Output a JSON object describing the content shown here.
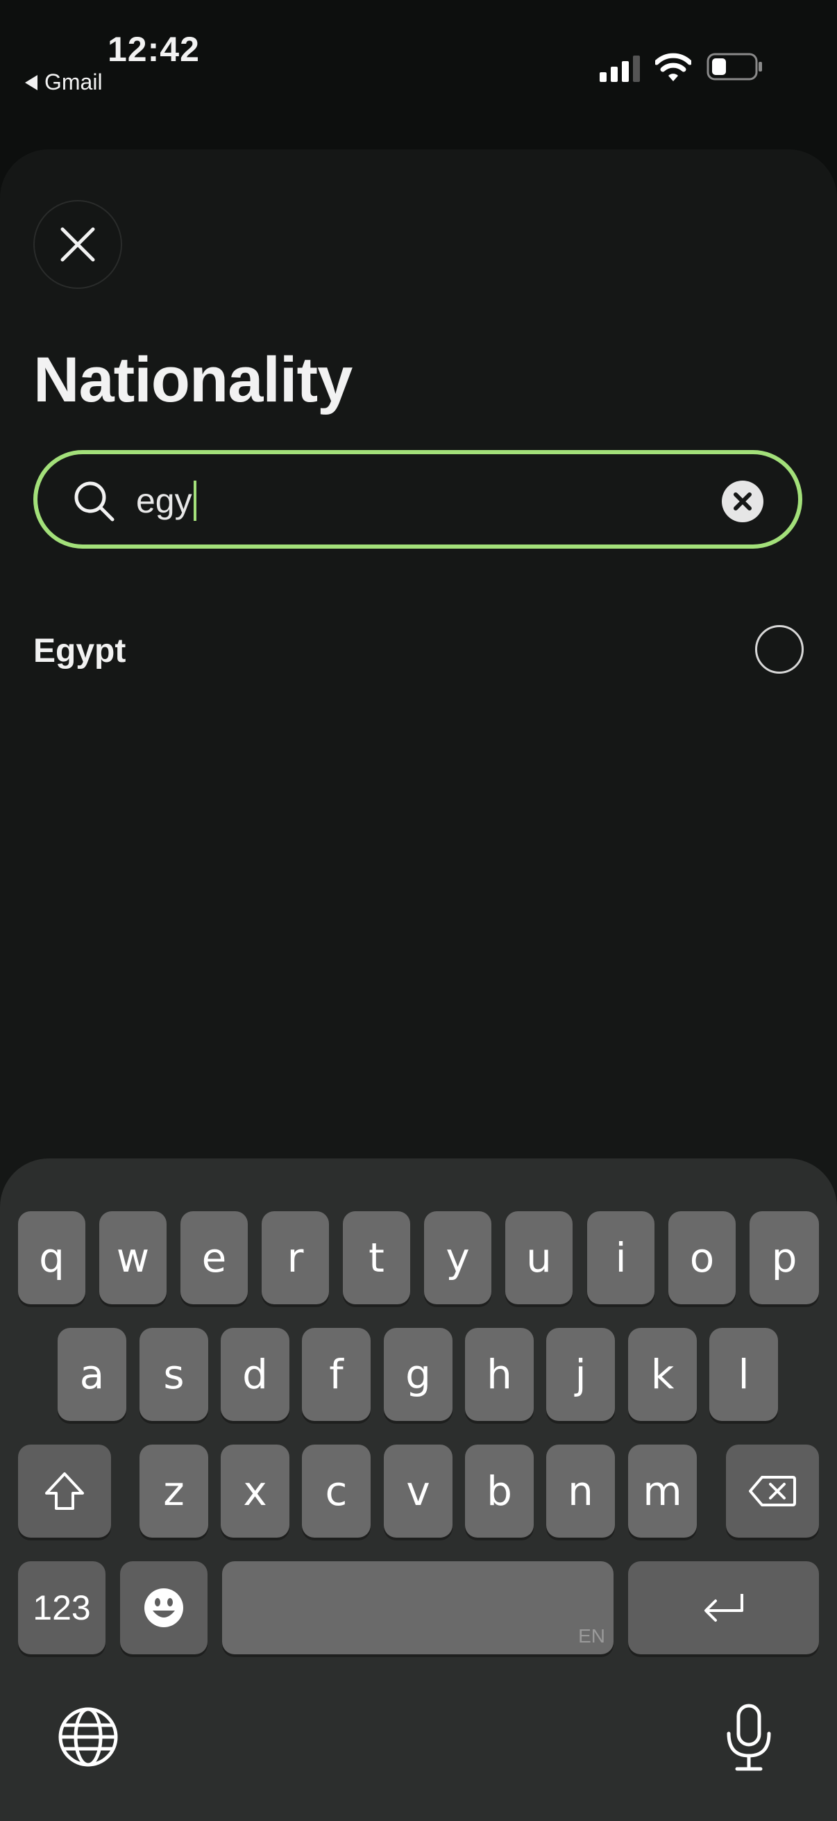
{
  "status_bar": {
    "time": "12:42",
    "back_app": "Gmail"
  },
  "page": {
    "title": "Nationality"
  },
  "search": {
    "value": "egy"
  },
  "results": [
    {
      "label": "Egypt",
      "selected": false
    }
  ],
  "keyboard": {
    "row1": [
      "q",
      "w",
      "e",
      "r",
      "t",
      "y",
      "u",
      "i",
      "o",
      "p"
    ],
    "row2": [
      "a",
      "s",
      "d",
      "f",
      "g",
      "h",
      "j",
      "k",
      "l"
    ],
    "row3": [
      "z",
      "x",
      "c",
      "v",
      "b",
      "n",
      "m"
    ],
    "numbers_label": "123",
    "space_lang": "EN"
  },
  "colors": {
    "accent": "#a3e07a",
    "background": "#151716",
    "keyboard": "#2c2e2d",
    "key": "#6a6a6a"
  },
  "icons": [
    "back-arrow-icon",
    "signal-icon",
    "wifi-icon",
    "battery-icon",
    "close-icon",
    "search-icon",
    "clear-icon",
    "shift-icon",
    "backspace-icon",
    "emoji-icon",
    "return-icon",
    "globe-icon",
    "microphone-icon"
  ]
}
